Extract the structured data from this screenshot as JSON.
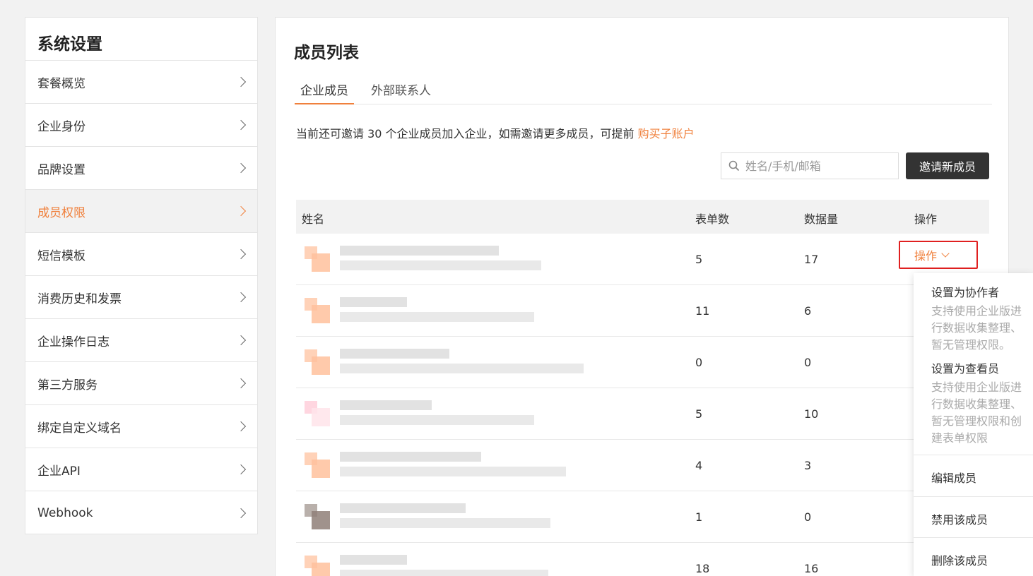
{
  "sidebar": {
    "title": "系统设置",
    "items": [
      {
        "label": "套餐概览",
        "active": false
      },
      {
        "label": "企业身份",
        "active": false
      },
      {
        "label": "品牌设置",
        "active": false
      },
      {
        "label": "成员权限",
        "active": true
      },
      {
        "label": "短信模板",
        "active": false
      },
      {
        "label": "消费历史和发票",
        "active": false
      },
      {
        "label": "企业操作日志",
        "active": false
      },
      {
        "label": "第三方服务",
        "active": false
      },
      {
        "label": "绑定自定义域名",
        "active": false
      },
      {
        "label": "企业API",
        "active": false
      },
      {
        "label": "Webhook",
        "active": false
      }
    ]
  },
  "main": {
    "title": "成员列表",
    "tabs": [
      {
        "label": "企业成员",
        "active": true
      },
      {
        "label": "外部联系人",
        "active": false
      }
    ],
    "notice": {
      "text": "当前还可邀请 30 个企业成员加入企业，如需邀请更多成员，可提前 ",
      "link": "购买子账户"
    },
    "search": {
      "placeholder": "姓名/手机/邮箱",
      "value": ""
    },
    "invite_button": "邀请新成员"
  },
  "table": {
    "headers": [
      "姓名",
      "表单数",
      "数据量",
      "操作"
    ],
    "rows": [
      {
        "forms": "5",
        "data": "17",
        "action": "操作"
      },
      {
        "forms": "11",
        "data": "6"
      },
      {
        "forms": "0",
        "data": "0"
      },
      {
        "forms": "5",
        "data": "10"
      },
      {
        "forms": "4",
        "data": "3"
      },
      {
        "forms": "1",
        "data": "0"
      },
      {
        "forms": "18",
        "data": "16"
      }
    ]
  },
  "dropdown": {
    "items": [
      {
        "label": "设置为协作者",
        "desc": "支持使用企业版进行数据收集整理、暂无管理权限。"
      },
      {
        "label": "设置为查看员",
        "desc": "支持使用企业版进行数据收集整理、暂无管理权限和创建表单权限"
      },
      {
        "label": "编辑成员"
      },
      {
        "label": "禁用该成员"
      },
      {
        "label": "删除该成员"
      }
    ]
  },
  "colors": {
    "accent": "#f0803c",
    "highlight_border": "#e02020",
    "button_dark": "#333333"
  },
  "icons": {
    "search": "search-icon",
    "chevron_right": "chevron-right-icon",
    "chevron_down": "chevron-down-icon"
  }
}
